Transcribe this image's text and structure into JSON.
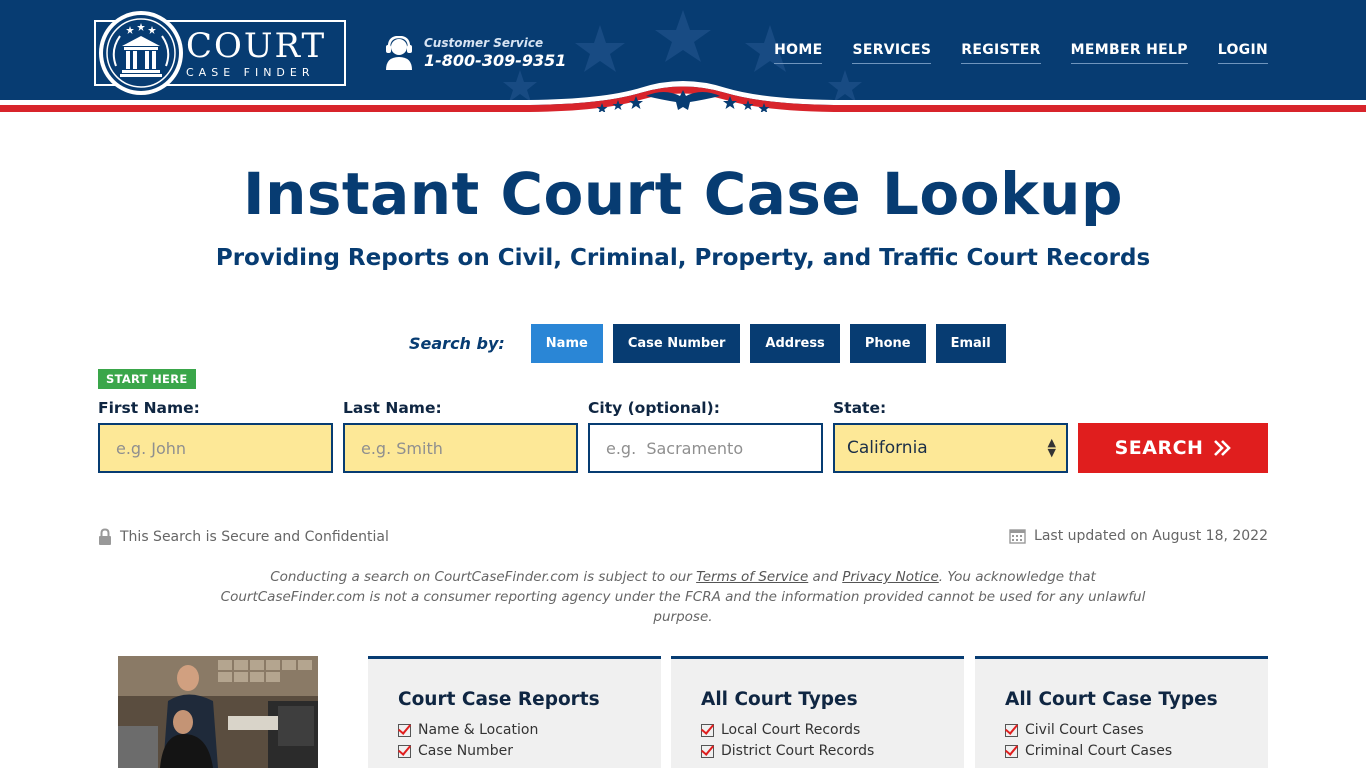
{
  "header": {
    "logo_word": "COURT",
    "logo_sub": "CASE FINDER",
    "customer_service_label": "Customer Service",
    "customer_service_phone": "1-800-309-9351",
    "nav": [
      "HOME",
      "SERVICES",
      "REGISTER",
      "MEMBER HELP",
      "LOGIN"
    ]
  },
  "hero": {
    "title": "Instant Court Case Lookup",
    "subtitle": "Providing Reports on Civil, Criminal, Property, and Traffic Court Records"
  },
  "search": {
    "search_by_label": "Search by:",
    "tabs": [
      "Name",
      "Case Number",
      "Address",
      "Phone",
      "Email"
    ],
    "active_tab": "Name",
    "start_here": "START HERE",
    "fields": {
      "first_name_label": "First Name:",
      "first_name_placeholder": "e.g. John",
      "last_name_label": "Last Name:",
      "last_name_placeholder": "e.g. Smith",
      "city_label": "City (optional):",
      "city_placeholder": "e.g.  Sacramento",
      "state_label": "State:",
      "state_value": "California"
    },
    "search_button": "SEARCH"
  },
  "notices": {
    "secure": "This Search is Secure and Confidential",
    "updated": "Last updated on August 18, 2022",
    "disclaimer_1": "Conducting a search on CourtCaseFinder.com is subject to our ",
    "terms_link": "Terms of Service",
    "disclaimer_and": " and ",
    "privacy_link": "Privacy Notice",
    "disclaimer_2": ". You acknowledge that CourtCaseFinder.com is not a consumer reporting agency under the FCRA and the information provided cannot be used for any unlawful purpose."
  },
  "cards": [
    {
      "title": "Court Case Reports",
      "items": [
        "Name & Location",
        "Case Number"
      ]
    },
    {
      "title": "All Court Types",
      "items": [
        "Local Court Records",
        "District Court Records"
      ]
    },
    {
      "title": "All Court Case Types",
      "items": [
        "Civil Court Cases",
        "Criminal Court Cases"
      ]
    }
  ],
  "colors": {
    "navy": "#073c72",
    "accent_blue": "#2a86d6",
    "red": "#e01e1e",
    "field_yellow": "#fde897",
    "badge_green": "#3aa64a"
  }
}
